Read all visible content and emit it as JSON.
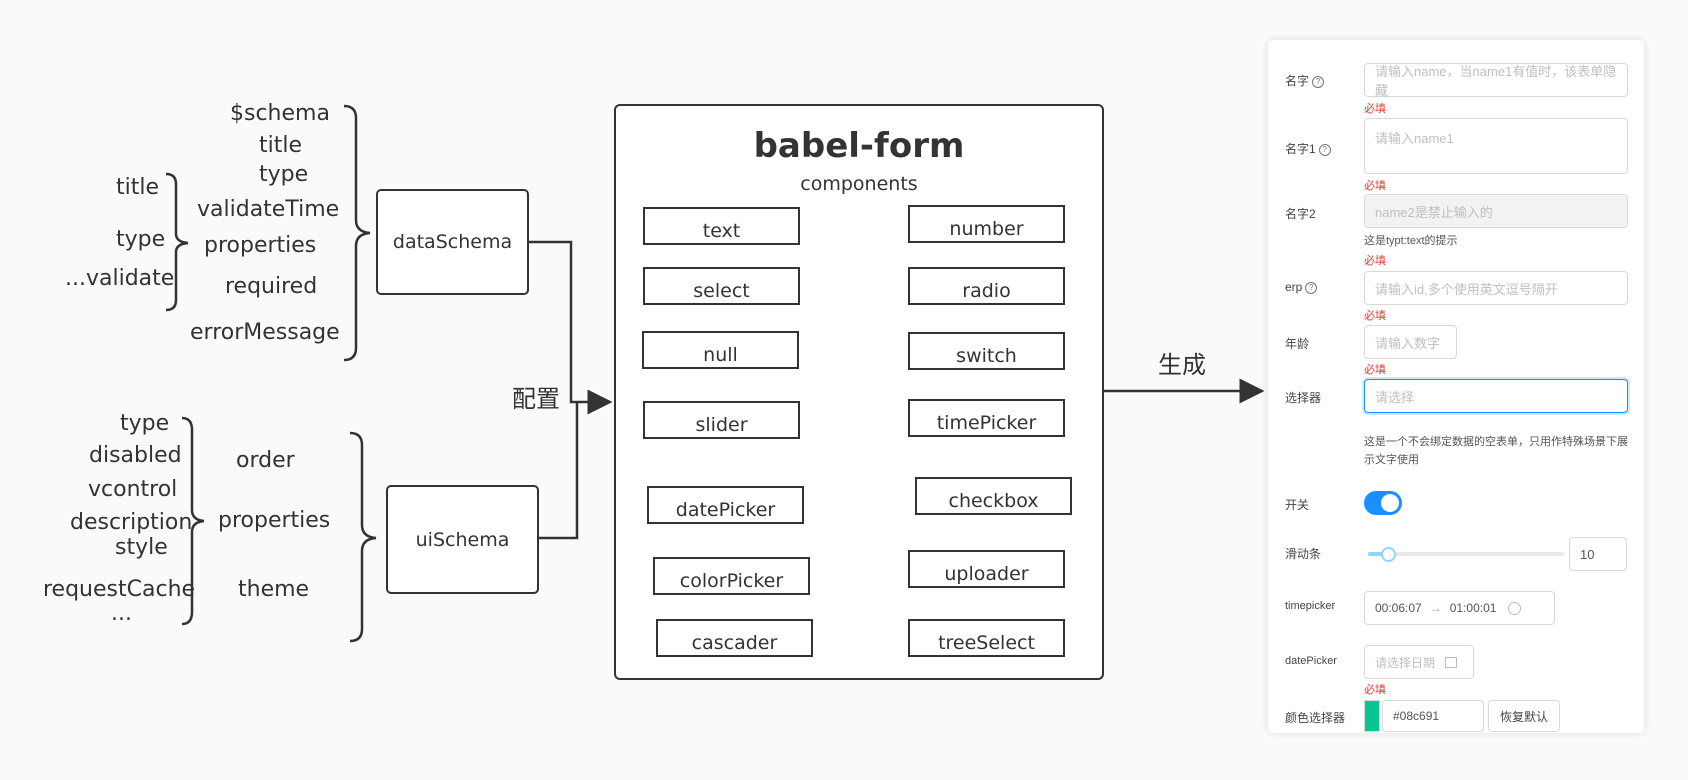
{
  "data_schema_fields": {
    "schema": "$schema",
    "title": "title",
    "type": "type",
    "validate_time": "validateTime",
    "properties": "properties",
    "required": "required",
    "error_message": "errorMessage"
  },
  "data_property_fields": {
    "title": "title",
    "type": "type",
    "validate": "...validate"
  },
  "ui_schema_fields": {
    "order": "order",
    "properties": "properties",
    "theme": "theme"
  },
  "ui_property_fields": {
    "type": "type",
    "disabled": "disabled",
    "vcontrol": "vcontrol",
    "description": "description",
    "style": "style",
    "request_cache": "requestCache",
    "ellipsis": "..."
  },
  "nodes": {
    "data_schema": "dataSchema",
    "ui_schema": "uiSchema"
  },
  "config_label": "配置",
  "generate_label": "生成",
  "babel_form": {
    "title": "babel-form",
    "subtitle": "components",
    "components": {
      "text": "text",
      "number": "number",
      "select": "select",
      "radio": "radio",
      "null": "null",
      "switch": "switch",
      "slider": "slider",
      "time_picker": "timePicker",
      "date_picker": "datePicker",
      "checkbox": "checkbox",
      "color_picker": "colorPicker",
      "uploader": "uploader",
      "cascader": "cascader",
      "tree_select": "treeSelect"
    }
  },
  "form_preview": {
    "name_label": "名字",
    "name_placeholder": "请输入name，当name1有值时，该表单隐藏",
    "name_required": "必填",
    "name1_label": "名字1",
    "name1_placeholder": "请输入name1",
    "name1_required": "必填",
    "name2_label": "名字2",
    "name2_placeholder": "name2是禁止输入的",
    "name2_help": "这是typt:text的提示",
    "name2_required": "必填",
    "erp_label": "erp",
    "erp_placeholder": "请输入id,多个使用英文逗号隔开",
    "erp_required": "必填",
    "age_label": "年龄",
    "age_placeholder": "请输入数字",
    "age_required": "必填",
    "selector_label": "选择器",
    "selector_placeholder": "请选择",
    "empty_form_note": "这是一个不会绑定数据的空表单，只用作特殊场景下展示文字使用",
    "switch_label": "开关",
    "switch_on": true,
    "slider_label": "滑动条",
    "slider_value": "10",
    "timepicker_label": "timepicker",
    "time_start": "00:06:07",
    "time_arrow": "→",
    "time_end": "01:00:01",
    "datepicker_label": "datePicker",
    "datepicker_placeholder": "请选择日期",
    "datepicker_required": "必填",
    "color_label": "颜色选择器",
    "color_value": "#08c691",
    "reset_button": "恢复默认"
  },
  "colors": {
    "primary": "#1890ff",
    "required": "#e53935",
    "swatch": "#08c691"
  }
}
